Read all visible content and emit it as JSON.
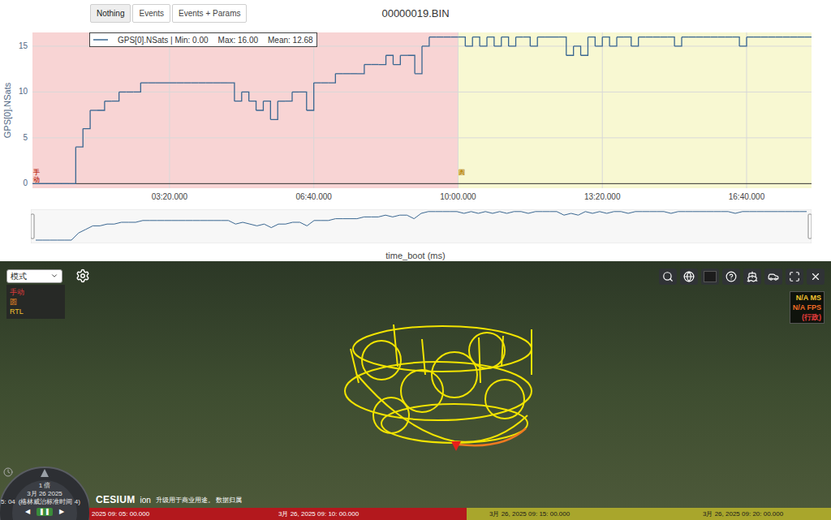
{
  "toolbar": {
    "buttons": [
      {
        "label": "Nothing",
        "selected": true
      },
      {
        "label": "Events",
        "selected": false
      },
      {
        "label": "Events + Params",
        "selected": false
      }
    ]
  },
  "title": "00000019.BIN",
  "chart": {
    "y_axis": {
      "title": "GPS[0].NSats",
      "min": -0.5,
      "max": 16.5,
      "ticks": [
        {
          "label": "0",
          "value": 0
        },
        {
          "label": "5",
          "value": 5
        },
        {
          "label": "10",
          "value": 10
        },
        {
          "label": "15",
          "value": 15
        }
      ]
    },
    "x_axis": {
      "title": "time_boot (ms)",
      "min": 10,
      "max": 1090,
      "ticks": [
        {
          "label": "03:20.000",
          "value": 200
        },
        {
          "label": "06:40.000",
          "value": 400
        },
        {
          "label": "10:00.000",
          "value": 600
        },
        {
          "label": "13:20.000",
          "value": 800
        },
        {
          "label": "16:40.000",
          "value": 1000
        }
      ]
    },
    "legend": [
      "GPS[0].NSats | Min: 0.00",
      "Max: 16.00",
      "Mean: 12.68"
    ],
    "series": [
      {
        "name": "GPS[0].NSats",
        "color": "#3a6791",
        "values": [
          0,
          0,
          0,
          0,
          0,
          0,
          4,
          6,
          8,
          8,
          9,
          9,
          10,
          10,
          10,
          11,
          11,
          11,
          11,
          11,
          11,
          11,
          11,
          11,
          11,
          11,
          11,
          11,
          9,
          10,
          9,
          8,
          9,
          7,
          9,
          9,
          10,
          10,
          8,
          11,
          11,
          11,
          12,
          12,
          12,
          12,
          13,
          13,
          13,
          14,
          13,
          14,
          14,
          12,
          15,
          16,
          16,
          16,
          16,
          16,
          15,
          16,
          15,
          16,
          15,
          16,
          15,
          16,
          16,
          15,
          16,
          16,
          16,
          16,
          14,
          15,
          14,
          16,
          15,
          16,
          15,
          16,
          16,
          15,
          16,
          16,
          16,
          16,
          16,
          15,
          16,
          16,
          16,
          16,
          16,
          16,
          16,
          16,
          15,
          16,
          16,
          16,
          16,
          16,
          16,
          16,
          16,
          16,
          16
        ]
      }
    ],
    "modes": [
      {
        "label": "手动",
        "start": 10,
        "color": "#c0392b",
        "fill": "#f8d4d4"
      },
      {
        "label": "圆",
        "start": 600,
        "color": "#b8860b",
        "fill": "#f8f8d2"
      }
    ]
  },
  "map": {
    "mode_select": {
      "label": "模式"
    },
    "mode_legend": [
      {
        "label": "手动",
        "color": "#e23b3b"
      },
      {
        "label": "圆",
        "color": "#f08a24"
      },
      {
        "label": "RTL",
        "color": "#f2c230"
      }
    ],
    "performance": [
      {
        "label": "N/A MS",
        "color": "#f2c230"
      },
      {
        "label": "N/A FPS",
        "color": "#f06a24"
      },
      {
        "label": "(行政)",
        "color": "#e23b3b"
      }
    ],
    "clock": {
      "speed": "1 倍",
      "date": "3月 26 2025",
      "time": "5: 04",
      "zone": "(格林威治标准时间 4)",
      "controls": [
        {
          "label": "◀",
          "selected": false
        },
        {
          "label": "❚❚",
          "selected": true
        },
        {
          "label": "▶",
          "selected": false
        }
      ]
    },
    "credits": {
      "logo": "CESIUM",
      "logo_suffix": "ion",
      "text": "升级用于商业用途。 数据归属"
    },
    "timeline": {
      "segments": [
        {
          "color": "#b3181d",
          "text_color": "#ffffff",
          "labels": [
            "2025 09: 05: 00.000",
            "3月 26,  2025 09: 10: 00.000"
          ]
        },
        {
          "color": "#a9a62c",
          "text_color": "#1a1a1a",
          "labels": [
            "3月 26,  2025 09: 15: 00.000",
            "3月 26,  2025 09: 20: 00.000"
          ]
        }
      ]
    }
  }
}
